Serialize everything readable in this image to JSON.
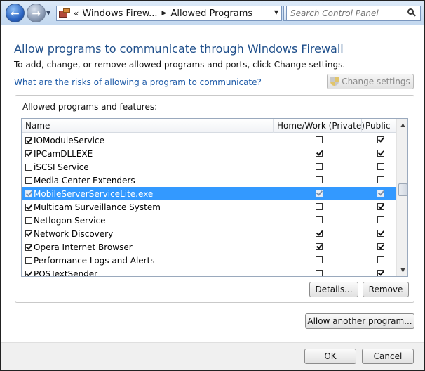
{
  "address": {
    "chevrons": "«",
    "crumbs": [
      "Windows Firew...",
      "Allowed Programs"
    ]
  },
  "search": {
    "placeholder": "Search Control Panel"
  },
  "main": {
    "title": "Allow programs to communicate through Windows Firewall",
    "description": "To add, change, or remove allowed programs and ports, click Change settings.",
    "risk_link": "What are the risks of allowing a program to communicate?",
    "change_settings": "Change settings"
  },
  "list": {
    "group_label": "Allowed programs and features:",
    "columns": [
      "Name",
      "Home/Work (Private)",
      "Public"
    ],
    "rows": [
      {
        "name": "IOModuleService",
        "enabled": true,
        "home": false,
        "public": true
      },
      {
        "name": "IPCamDLLEXE",
        "enabled": true,
        "home": true,
        "public": true
      },
      {
        "name": "iSCSI Service",
        "enabled": false,
        "home": false,
        "public": false
      },
      {
        "name": "Media Center Extenders",
        "enabled": false,
        "home": false,
        "public": false
      },
      {
        "name": "MobileServerServiceLite.exe",
        "enabled": true,
        "home": true,
        "public": true,
        "selected": true
      },
      {
        "name": "Multicam Surveillance System",
        "enabled": true,
        "home": false,
        "public": true
      },
      {
        "name": "Netlogon Service",
        "enabled": false,
        "home": false,
        "public": false
      },
      {
        "name": "Network Discovery",
        "enabled": true,
        "home": true,
        "public": true
      },
      {
        "name": "Opera Internet Browser",
        "enabled": true,
        "home": true,
        "public": true
      },
      {
        "name": "Performance Logs and Alerts",
        "enabled": false,
        "home": false,
        "public": false
      },
      {
        "name": "POSTextSender",
        "enabled": true,
        "home": false,
        "public": true
      }
    ]
  },
  "buttons": {
    "details": "Details...",
    "remove": "Remove",
    "allow_another": "Allow another program...",
    "ok": "OK",
    "cancel": "Cancel"
  }
}
